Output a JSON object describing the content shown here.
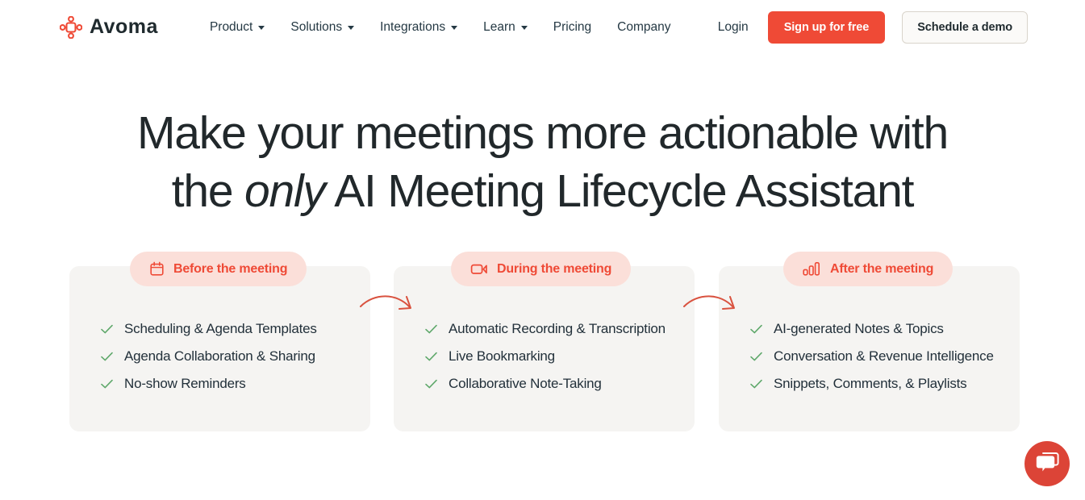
{
  "brand": {
    "name": "Avoma",
    "logo_icon": "avoma-logo-icon",
    "accent_red": "#ef4a36",
    "pill_bg": "#fbdfd9",
    "card_bg": "#f5f4f2",
    "check_green": "#5fa86b",
    "text_dark": "#21282b"
  },
  "header": {
    "nav": [
      {
        "label": "Product",
        "has_caret": true
      },
      {
        "label": "Solutions",
        "has_caret": true
      },
      {
        "label": "Integrations",
        "has_caret": true
      },
      {
        "label": "Learn",
        "has_caret": true
      },
      {
        "label": "Pricing",
        "has_caret": false
      },
      {
        "label": "Company",
        "has_caret": false
      }
    ],
    "login_label": "Login",
    "signup_label": "Sign up for free",
    "demo_label": "Schedule a demo"
  },
  "hero": {
    "line1": "Make your meetings more actionable with",
    "line2_pre": "the ",
    "line2_em": "only",
    "line2_post": " AI Meeting Lifecycle Assistant"
  },
  "stages": [
    {
      "pill_label": "Before the meeting",
      "pill_icon": "calendar-icon",
      "features": [
        "Scheduling & Agenda Templates",
        "Agenda Collaboration & Sharing",
        "No-show Reminders"
      ]
    },
    {
      "pill_label": "During the meeting",
      "pill_icon": "video-camera-icon",
      "features": [
        "Automatic Recording & Transcription",
        "Live Bookmarking",
        "Collaborative Note-Taking"
      ]
    },
    {
      "pill_label": "After the meeting",
      "pill_icon": "bar-chart-icon",
      "features": [
        "AI-generated Notes & Topics",
        "Conversation & Revenue Intelligence",
        "Snippets, Comments, & Playlists"
      ]
    }
  ],
  "chat": {
    "icon": "chat-bubble-icon"
  }
}
